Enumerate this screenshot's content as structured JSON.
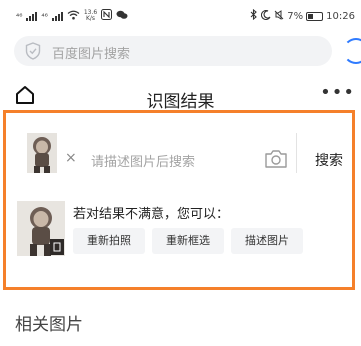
{
  "status_bar": {
    "network_left": "⁴⁶",
    "network_right": "⁴⁶",
    "net_speed_value": "13.6",
    "net_speed_unit": "K/s",
    "battery_percent": "7%",
    "time": "10:26"
  },
  "search": {
    "placeholder": "百度图片搜索"
  },
  "header": {
    "title": "识图结果",
    "more": "•••"
  },
  "query": {
    "remove_label": "×",
    "placeholder": "请描述图片后搜索",
    "search_label": "搜索"
  },
  "feedback": {
    "prompt": "若对结果不满意，您可以：",
    "actions": [
      {
        "label": "重新拍照"
      },
      {
        "label": "重新框选"
      },
      {
        "label": "描述图片"
      }
    ]
  },
  "section": {
    "related_title": "相关图片"
  },
  "colors": {
    "accent_orange": "#f5802a",
    "brand_blue": "#2f7bff"
  },
  "icons": [
    "signal-icon",
    "wifi-icon",
    "nfc-icon",
    "chat-icon",
    "bluetooth-icon",
    "moon-icon",
    "mute-icon",
    "battery-icon",
    "shield-icon",
    "home-icon",
    "camera-icon"
  ]
}
